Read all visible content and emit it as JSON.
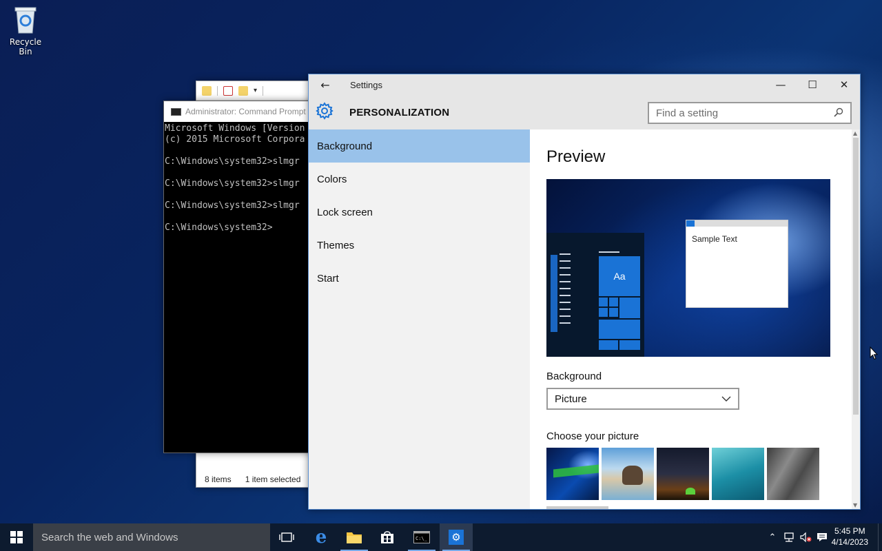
{
  "desktop": {
    "recycle_bin_label": "Recycle Bin"
  },
  "explorer": {
    "items_count": "8 items",
    "selection": "1 item selected"
  },
  "cmd": {
    "title": "Administrator: Command Prompt",
    "lines": [
      "Microsoft Windows [Version",
      "(c) 2015 Microsoft Corpora",
      "",
      "C:\\Windows\\system32>slmgr",
      "",
      "C:\\Windows\\system32>slmgr",
      "",
      "C:\\Windows\\system32>slmgr",
      "",
      "C:\\Windows\\system32>"
    ]
  },
  "settings": {
    "window_title": "Settings",
    "section_heading": "PERSONALIZATION",
    "search": {
      "placeholder": "Find a setting"
    },
    "nav": [
      {
        "label": "Background",
        "active": true
      },
      {
        "label": "Colors",
        "active": false
      },
      {
        "label": "Lock screen",
        "active": false
      },
      {
        "label": "Themes",
        "active": false
      },
      {
        "label": "Start",
        "active": false
      }
    ],
    "preview": {
      "title": "Preview",
      "tile_label": "Aa",
      "sample_text": "Sample Text"
    },
    "background_label": "Background",
    "background_value": "Picture",
    "choose_picture_label": "Choose your picture",
    "pictures": [
      "windows-hero",
      "rock-arch-beach",
      "milky-way-tent",
      "underwater-swimmer",
      "rock-cliff"
    ]
  },
  "taskbar": {
    "search_placeholder": "Search the web and Windows",
    "apps": [
      "task-view",
      "edge",
      "file-explorer",
      "store",
      "command-prompt",
      "settings"
    ],
    "clock": {
      "time": "5:45 PM",
      "date": "4/14/2023"
    }
  },
  "colors": {
    "accent": "#1a73d6",
    "nav_selected": "#99c2ea",
    "taskbar": "#0d1b2f"
  }
}
